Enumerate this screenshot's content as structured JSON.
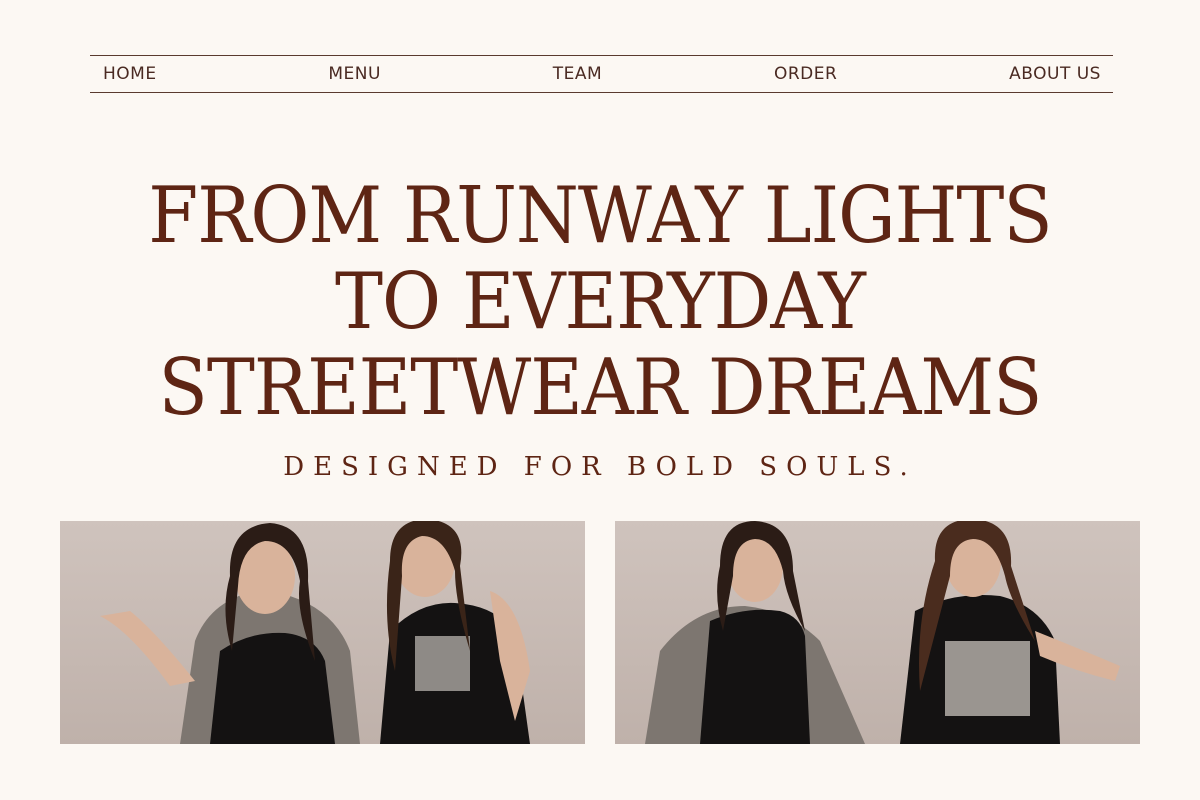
{
  "nav": {
    "items": [
      {
        "label": "HOME"
      },
      {
        "label": "MENU"
      },
      {
        "label": "TEAM"
      },
      {
        "label": "ORDER"
      },
      {
        "label": "ABOUT US"
      }
    ]
  },
  "hero": {
    "lines": [
      "FROM RUNWAY LIGHTS",
      "TO EVERYDAY",
      "STREETWEAR DREAMS"
    ],
    "tagline": "DESIGNED FOR BOLD SOULS."
  },
  "photos": [
    {
      "name": "photo-left"
    },
    {
      "name": "photo-right"
    }
  ],
  "colors": {
    "background": "#fcf8f3",
    "text": "#5e2514",
    "nav_text": "#4a2a22",
    "rule": "#5a3a2e"
  }
}
